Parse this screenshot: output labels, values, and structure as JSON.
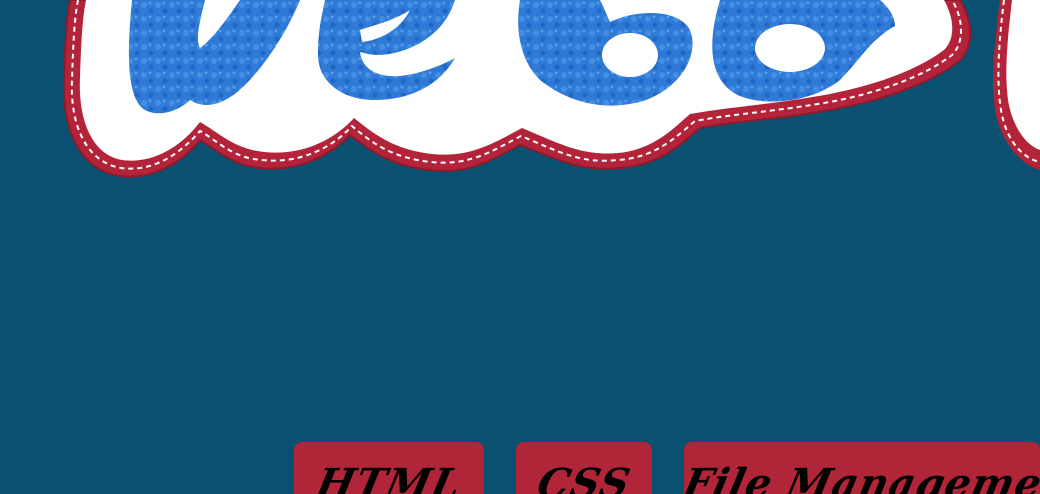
{
  "logo": {
    "text": "Web",
    "fill_color": "#2f7ad6",
    "outline_color": "#b3243a",
    "inner_color": "#ffffff"
  },
  "nav": {
    "items": [
      {
        "label": "HTML"
      },
      {
        "label": "CSS"
      },
      {
        "label": "File Management"
      }
    ],
    "tab_color": "#b02537"
  },
  "page": {
    "background": "#0a5070"
  }
}
